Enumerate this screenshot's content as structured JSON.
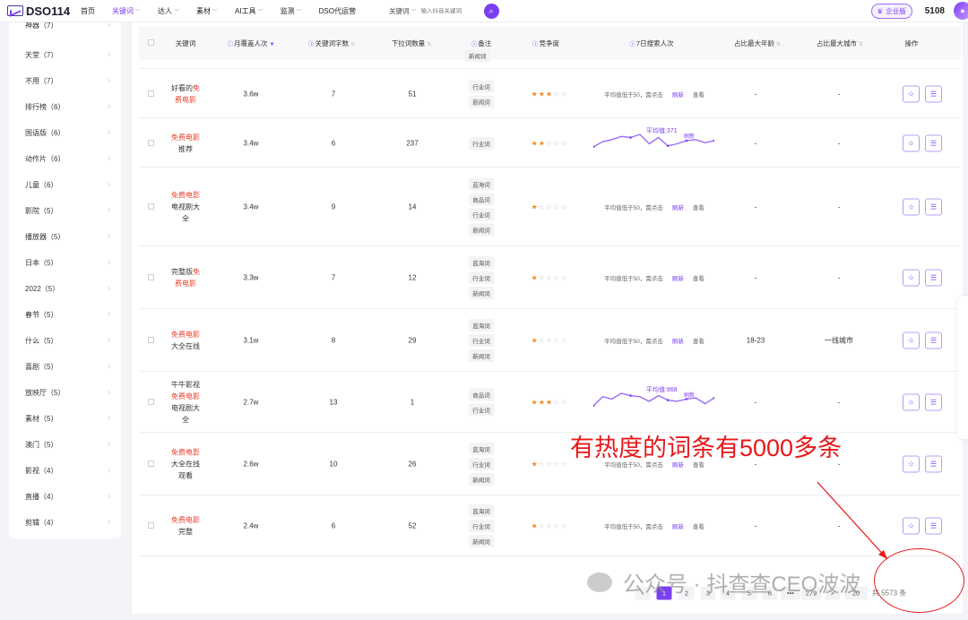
{
  "header": {
    "logo_text": "DSO114",
    "nav": [
      {
        "label": "首页",
        "caret": false,
        "active": false
      },
      {
        "label": "关键词",
        "caret": true,
        "active": true
      },
      {
        "label": "达人",
        "caret": true,
        "active": false
      },
      {
        "label": "素材",
        "caret": true,
        "active": false
      },
      {
        "label": "AI工具",
        "caret": true,
        "active": false
      },
      {
        "label": "监测",
        "caret": true,
        "active": false
      },
      {
        "label": "DSO代运营",
        "caret": false,
        "active": false
      }
    ],
    "search_type": "关键词",
    "search_placeholder": "输入抖音关键词",
    "enterprise_label": "企业版",
    "points": "5108"
  },
  "sidebar": {
    "items": [
      {
        "label": "神器（7）"
      },
      {
        "label": "天堂（7）"
      },
      {
        "label": "不用（7）"
      },
      {
        "label": "排行榜（6）"
      },
      {
        "label": "国语版（6）"
      },
      {
        "label": "动作片（6）"
      },
      {
        "label": "儿童（6）"
      },
      {
        "label": "影院（5）"
      },
      {
        "label": "播放器（5）"
      },
      {
        "label": "日本（5）"
      },
      {
        "label": "2022（5）"
      },
      {
        "label": "春节（5）"
      },
      {
        "label": "什么（5）"
      },
      {
        "label": "喜剧（5）"
      },
      {
        "label": "放映厅（5）"
      },
      {
        "label": "素材（5）"
      },
      {
        "label": "澳门（5）"
      },
      {
        "label": "影视（4）"
      },
      {
        "label": "直播（4）"
      },
      {
        "label": "剪辑（4）"
      }
    ]
  },
  "table": {
    "headers": {
      "keyword": "关键词",
      "monthly_cover": "月覆盖人次",
      "char_count": "关键词字数",
      "dropdown_count": "下拉词数量",
      "note": "备注",
      "competition": "竞争度",
      "search_7d": "7日搜索人次",
      "max_age": "占比最大年龄",
      "max_city": "占比最大城市",
      "actions": "操作"
    },
    "top_partial_tag": "新闻词",
    "low_avg_text": "平均值低于50，需点击",
    "refresh_label": "刷新",
    "view_label": "查看",
    "rows": [
      {
        "kw_parts": [
          {
            "t": "好看的",
            "hl": false
          },
          {
            "t": "免",
            "hl": true
          },
          {
            "t": "费电影",
            "hl": true
          }
        ],
        "kw_lines": [
          "好看的免",
          "费电影"
        ],
        "cover": "3.6w",
        "chars": "7",
        "dropdown": "51",
        "tags": [
          "行业词",
          "新闻词"
        ],
        "stars": 3,
        "trend": "low",
        "age": "-",
        "city": "-"
      },
      {
        "kw_lines": [
          "免费电影",
          "推荐"
        ],
        "cover": "3.4w",
        "chars": "6",
        "dropdown": "237",
        "tags": [
          "行业词"
        ],
        "stars": 2,
        "trend": "chart",
        "avg_label": "平均值:371",
        "age": "-",
        "city": "-"
      },
      {
        "kw_lines": [
          "免费电影",
          "电视剧大",
          "全"
        ],
        "cover": "3.4w",
        "chars": "9",
        "dropdown": "14",
        "tags": [
          "蓝海词",
          "商品词",
          "行业词",
          "新闻词"
        ],
        "stars": 1,
        "trend": "low",
        "age": "-",
        "city": "-"
      },
      {
        "kw_lines": [
          "完整版免",
          "费电影"
        ],
        "cover": "3.3w",
        "chars": "7",
        "dropdown": "12",
        "tags": [
          "蓝海词",
          "行业词",
          "新闻词"
        ],
        "stars": 1,
        "trend": "low",
        "age": "-",
        "city": "-"
      },
      {
        "kw_lines": [
          "免费电影",
          "大全在线"
        ],
        "cover": "3.1w",
        "chars": "8",
        "dropdown": "29",
        "tags": [
          "蓝海词",
          "行业词",
          "新闻词"
        ],
        "stars": 1,
        "trend": "low",
        "age": "18-23",
        "city": "一线城市"
      },
      {
        "kw_lines": [
          "牛牛影视",
          "免费电影",
          "电视剧大",
          "全"
        ],
        "cover": "2.7w",
        "chars": "13",
        "dropdown": "1",
        "tags": [
          "商品词",
          "行业词"
        ],
        "stars": 3,
        "trend": "chart",
        "avg_label": "平均值:868",
        "age": "-",
        "city": "-"
      },
      {
        "kw_lines": [
          "免费电影",
          "大全在线",
          "观看"
        ],
        "cover": "2.6w",
        "chars": "10",
        "dropdown": "26",
        "tags": [
          "蓝海词",
          "行业词",
          "新闻词"
        ],
        "stars": 1,
        "trend": "low",
        "age": "-",
        "city": "-"
      },
      {
        "kw_lines": [
          "免费电影",
          "完整"
        ],
        "cover": "2.4w",
        "chars": "6",
        "dropdown": "52",
        "tags": [
          "蓝海词",
          "行业词",
          "新闻词"
        ],
        "stars": 1,
        "trend": "low",
        "age": "-",
        "city": "-"
      }
    ]
  },
  "annotation": "有热度的词条有5000多条",
  "watermark": "公众号 · 抖查查CEO波波",
  "pagination": {
    "pages": [
      "1",
      "2",
      "3",
      "4",
      "5",
      "6",
      "•••",
      "279"
    ],
    "active": "1",
    "next_label": ">",
    "size_label": "20",
    "total_label": "共 5573 条"
  },
  "colors": {
    "accent": "#7b3ff2",
    "highlight": "#e8412c",
    "annotation": "#e8181b",
    "star": "#f08a24"
  }
}
